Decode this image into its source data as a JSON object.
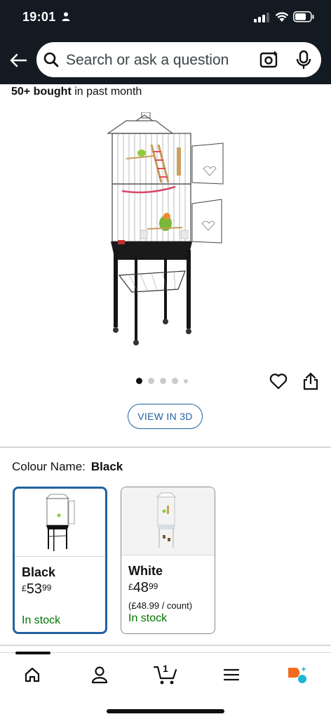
{
  "status_bar": {
    "time": "19:01"
  },
  "search": {
    "placeholder": "Search or ask a question"
  },
  "product": {
    "bought_bold": "50+ bought",
    "bought_rest": " in past month",
    "image_count": 5,
    "active_image": 1
  },
  "view3d": {
    "label": "VIEW IN 3D"
  },
  "colour": {
    "label": "Colour Name:",
    "selected": "Black",
    "options": [
      {
        "name": "Black",
        "currency": "£",
        "whole": "53",
        "fraction": "99",
        "unit_price": "",
        "stock": "In stock",
        "selected": true
      },
      {
        "name": "White",
        "currency": "£",
        "whole": "48",
        "fraction": "99",
        "unit_price": "(£48.99 / count)",
        "stock": "In stock",
        "selected": false
      }
    ]
  },
  "nav": {
    "cart_count": "1"
  },
  "colors": {
    "header": "#131a22",
    "link": "#2162a1",
    "stock": "#007600"
  }
}
